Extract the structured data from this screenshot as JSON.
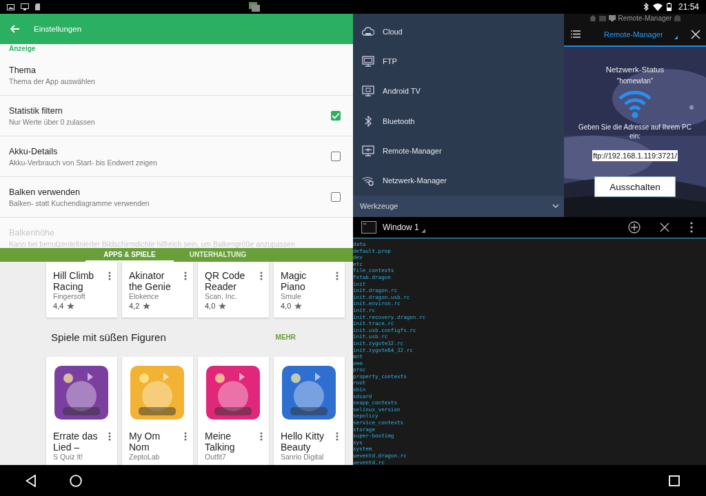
{
  "status_bar": {
    "time": "21:54"
  },
  "settings": {
    "title": "Einstellungen",
    "section": "Anzeige",
    "items": [
      {
        "kind": "plain",
        "title": "Thema",
        "subtitle": "Thema der App auswählen",
        "disabled": false
      },
      {
        "kind": "checkbox",
        "title": "Statistik filtern",
        "subtitle": "Nur Werte über 0 zulassen",
        "checked": true,
        "disabled": false
      },
      {
        "kind": "checkbox",
        "title": "Akku-Details",
        "subtitle": "Akku-Verbrauch von Start- bis Endwert zeigen",
        "checked": false,
        "disabled": false
      },
      {
        "kind": "checkbox",
        "title": "Balken verwenden",
        "subtitle": "Balken- statt Kuchendiagramme verwenden",
        "checked": false,
        "disabled": false
      },
      {
        "kind": "plain",
        "title": "Balkenhöhe",
        "subtitle": "Kann bei benutzerdefinierter Bildschirmdichte hilfreich sein, um Balkengröße anzupassen",
        "disabled": true
      }
    ]
  },
  "store": {
    "tabs": [
      {
        "label": "APPS & SPIELE",
        "selected": true
      },
      {
        "label": "UNTERHALTUNG",
        "selected": false
      }
    ],
    "top_apps": [
      {
        "name": "Hill Climb Racing",
        "developer": "Fingersoft",
        "rating": "4,4"
      },
      {
        "name": "Akinator the Genie",
        "developer": "Elokence",
        "rating": "4,2"
      },
      {
        "name": "QR Code Reader",
        "developer": "Scan, Inc.",
        "rating": "4,0"
      },
      {
        "name": "Magic Piano",
        "developer": "Smule",
        "rating": "4,0"
      }
    ],
    "section_title": "Spiele mit süßen Figuren",
    "more": "MEHR",
    "games": [
      {
        "name": "Errate das Lied –",
        "developer": "S Quiz It!",
        "color": "#7b3fa0"
      },
      {
        "name": "My Om Nom",
        "developer": "ZeptoLab",
        "color": "#f2b233"
      },
      {
        "name": "Meine Talking",
        "developer": "Outfit7",
        "color": "#e0277a"
      },
      {
        "name": "Hello Kitty Beauty",
        "developer": "Sanrio Digital",
        "color": "#2f6fd0"
      }
    ]
  },
  "drawer": {
    "items": [
      {
        "kind": "cloud",
        "label": "Cloud"
      },
      {
        "kind": "ftp",
        "label": "FTP"
      },
      {
        "kind": "tv",
        "label": "Android TV"
      },
      {
        "kind": "bluetooth",
        "label": "Bluetooth"
      },
      {
        "kind": "remote",
        "label": "Remote-Manager"
      },
      {
        "kind": "network",
        "label": "Netzwerk-Manager"
      }
    ],
    "footer": "Werkzeuge"
  },
  "remote": {
    "window_title": "Remote-Manager",
    "title": "Remote-Manager",
    "status": "Netzwerk-Status",
    "network": "\"homewlan\"",
    "hint": "Geben Sie die Adresse auf Ihrem PC ein:",
    "address": "ftp://192.168.1.119:3721/",
    "button": "Ausschalten"
  },
  "terminal": {
    "title": "Window 1",
    "lines": [
      "data",
      "default.prop",
      "dev",
      "etc",
      "file_contexts",
      "fstab.dragon",
      "init",
      "init.dragon.rc",
      "init.dragon.usb.rc",
      "init.environ.rc",
      "init.rc",
      "init.recovery.dragon.rc",
      "init.trace.rc",
      "init.usb.configfs.rc",
      "init.usb.rc",
      "init.zygote32.rc",
      "init.zygote64_32.rc",
      "mnt",
      "oem",
      "proc",
      "property_contexts",
      "root",
      "sbin",
      "sdcard",
      "seapp_contexts",
      "selinux_version",
      "sepolicy",
      "service_contexts",
      "storage",
      "super-bootimg",
      "sys",
      "system",
      "ueventd.dragon.rc",
      "ueventd.rc"
    ]
  }
}
